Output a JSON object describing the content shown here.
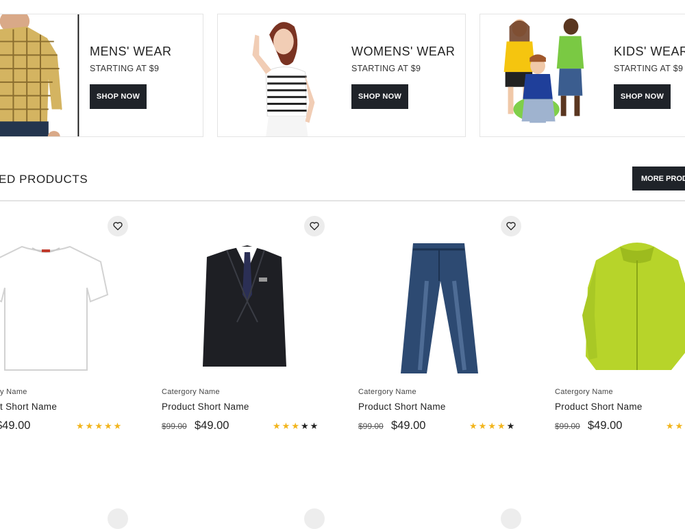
{
  "banners": [
    {
      "title": "MENS' WEAR",
      "subtitle": "STARTING AT $9",
      "button": "SHOP NOW"
    },
    {
      "title": "WOMENS' WEAR",
      "subtitle": "STARTING AT $9",
      "button": "SHOP NOW"
    },
    {
      "title": "KIDS' WEAR",
      "subtitle": "STARTING AT $9",
      "button": "SHOP NOW"
    }
  ],
  "section": {
    "title": "ED PRODUCTS",
    "more_button": "MORE PRODU"
  },
  "products": [
    {
      "category": "y Name",
      "name": "t Short Name",
      "old_price": "",
      "price": "$49.00",
      "rating": 5,
      "color": "#ffffff"
    },
    {
      "category": "Catergory Name",
      "name": "Product Short Name",
      "old_price": "$99.00",
      "price": "$49.00",
      "rating": 3,
      "color": "#1e1f24"
    },
    {
      "category": "Catergory Name",
      "name": "Product Short Name",
      "old_price": "$99.00",
      "price": "$49.00",
      "rating": 4,
      "color": "#2d4a72"
    },
    {
      "category": "Catergory Name",
      "name": "Product Short Name",
      "old_price": "$99.00",
      "price": "$49.00",
      "rating": 2,
      "color": "#b7d42a"
    }
  ]
}
